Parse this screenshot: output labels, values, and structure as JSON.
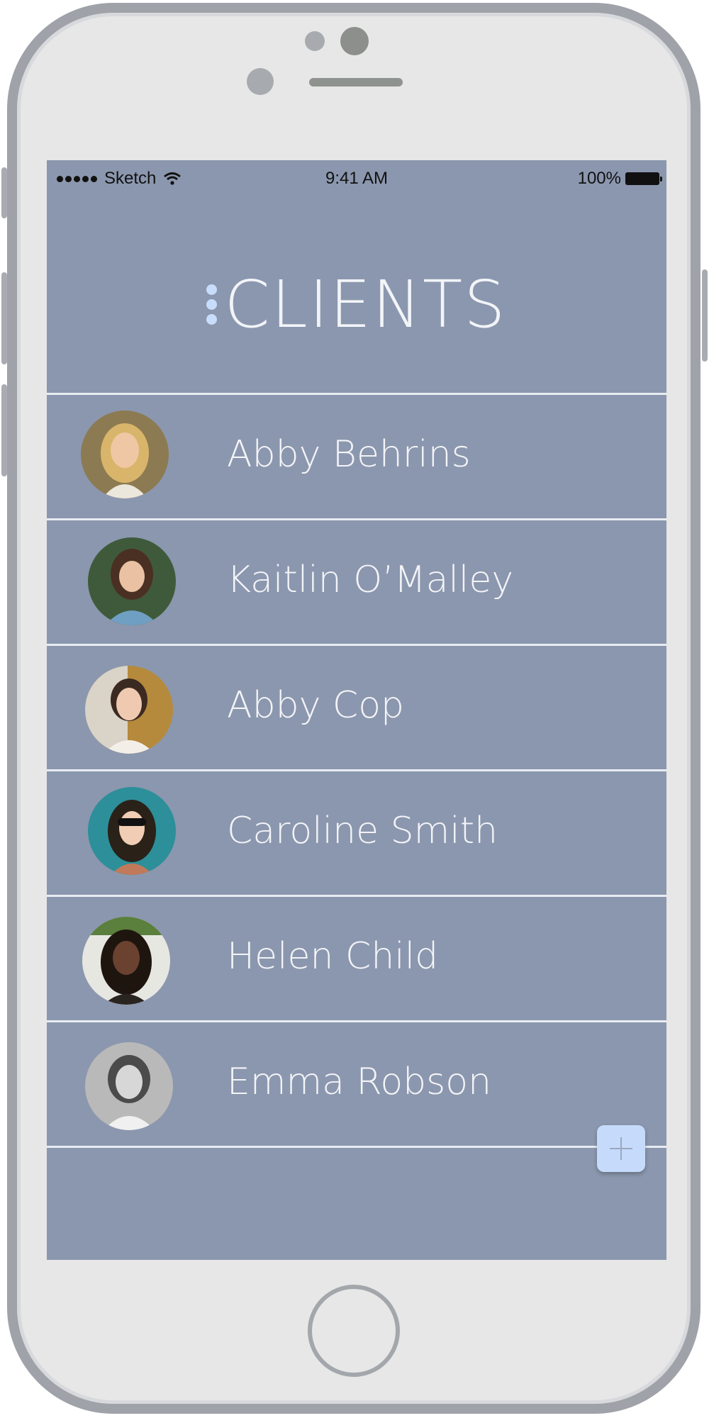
{
  "status_bar": {
    "carrier": "Sketch",
    "time": "9:41 AM",
    "battery": "100%"
  },
  "header": {
    "title": "CLIENTS",
    "menu_icon": "vertical-dots-icon"
  },
  "clients": [
    {
      "name": "Abby Behrins"
    },
    {
      "name": "Kaitlin O’Malley"
    },
    {
      "name": "Abby Cop"
    },
    {
      "name": "Caroline Smith"
    },
    {
      "name": "Helen Child"
    },
    {
      "name": "Emma Robson"
    }
  ],
  "fab": {
    "icon": "plus-icon"
  },
  "colors": {
    "screen_background": "#8b97ae",
    "accent": "#c6dbfb",
    "divider": "#e8ecf2"
  }
}
